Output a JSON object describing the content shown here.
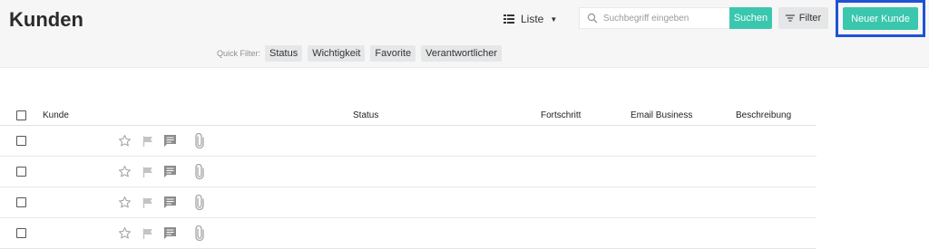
{
  "header": {
    "title": "Kunden",
    "view_label": "Liste",
    "search_placeholder": "Suchbegriff eingeben",
    "search_button": "Suchen",
    "filter_button": "Filter",
    "new_button": "Neuer Kunde"
  },
  "quick_filter": {
    "label": "Quick Filter:",
    "chips": [
      "Status",
      "Wichtigkeit",
      "Favorite",
      "Verantwortlicher"
    ]
  },
  "table": {
    "columns": {
      "kunde": "Kunde",
      "status": "Status",
      "fortschritt": "Fortschritt",
      "email": "Email Business",
      "beschreibung": "Beschreibung"
    },
    "row_count": 4
  },
  "colors": {
    "accent": "#3ac7ae",
    "highlight_border": "#1f52d6",
    "icon_gray": "#a6a6a6",
    "comment_icon": "#8c8c8c"
  },
  "icons": [
    "list-icon",
    "chevron-down-icon",
    "search-icon",
    "filter-icon",
    "star-icon",
    "flag-icon",
    "comment-icon",
    "paperclip-icon"
  ]
}
